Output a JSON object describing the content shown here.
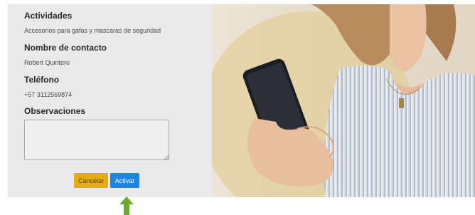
{
  "form": {
    "activities_label": "Actividades",
    "activities_value": "Accesorios para gafas y mascaras de seguridad",
    "contact_label": "Nombre de contacto",
    "contact_value": "Robert Quintero",
    "phone_label": "Teléfono",
    "phone_value": "+57 3112569874",
    "notes_label": "Observaciones",
    "notes_value": ""
  },
  "actions": {
    "cancel_label": "Cancelar",
    "activate_label": "Activar"
  },
  "colors": {
    "panel_bg": "#e9e9e9",
    "cancel_button": "#e3ad13",
    "activate_button": "#1a86e8",
    "arrow": "#6bab2f"
  },
  "icons": {
    "pointer": "arrow-up-icon"
  }
}
